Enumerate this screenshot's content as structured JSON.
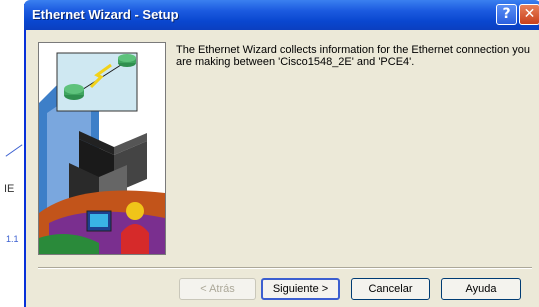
{
  "background": {
    "label_1": "IE",
    "label_2": "1.1"
  },
  "window": {
    "title": "Ethernet Wizard - Setup",
    "help_glyph": "?",
    "close_glyph": "✕"
  },
  "wizard": {
    "description": "The Ethernet Wizard collects information for the Ethernet connection you are making between 'Cisco1548_2E' and 'PCE4'."
  },
  "buttons": {
    "back": "< Atrás",
    "next": "Siguiente >",
    "cancel": "Cancelar",
    "help": "Ayuda"
  },
  "colors": {
    "titlebar": "#0a47d0",
    "dialog_bg": "#ece9d8",
    "default_button_border": "#3c5fd0"
  }
}
